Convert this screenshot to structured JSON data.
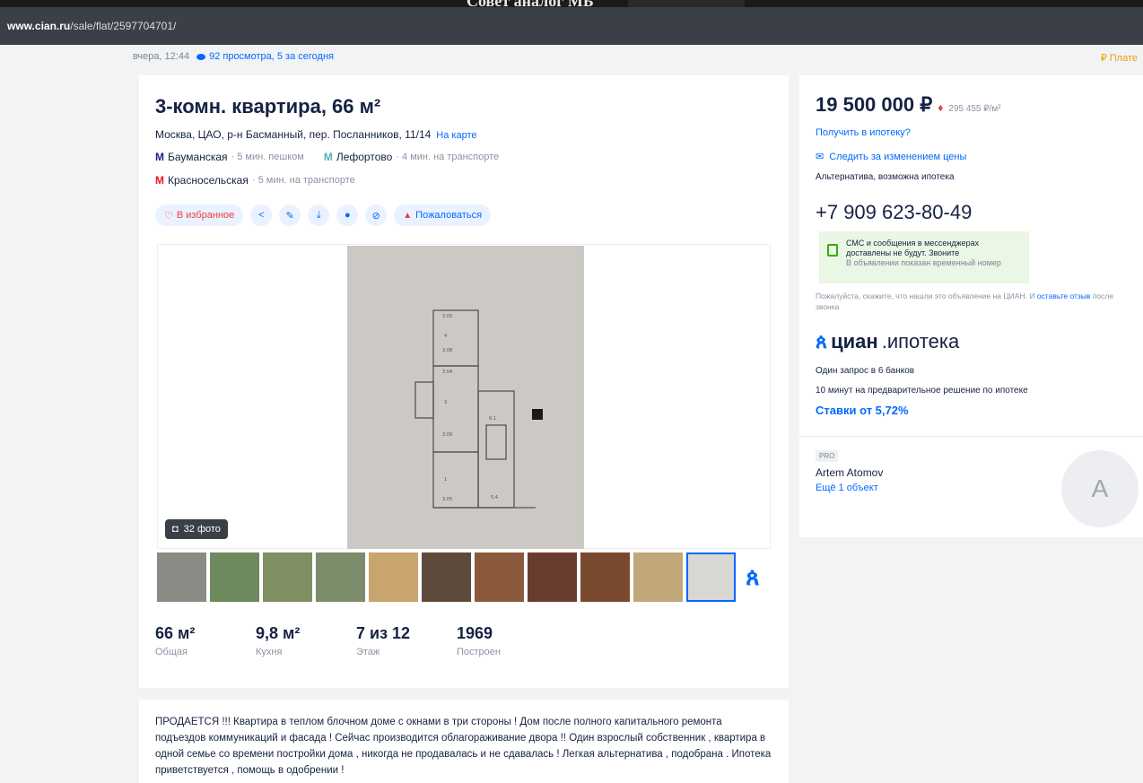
{
  "window": {
    "title": "Совет аналог МБ",
    "url_host": "www.cian.ru",
    "url_path": "/sale/flat/2597704701/"
  },
  "meta": {
    "date": "вчера, 12:44",
    "views": "92 просмотра, 5 за сегодня",
    "pay": "₽ Плате"
  },
  "listing": {
    "title": "3-комн. квартира, 66 м²",
    "address": "Москва, ЦАО, р-н Басманный, пер. Посланников, 11/14",
    "map_link": "На карте",
    "metro": [
      {
        "name": "Бауманская",
        "time": "· 5 мин. пешком",
        "color": "#1a1a8c"
      },
      {
        "name": "Лефортово",
        "time": "· 4 мин. на транспорте",
        "color": "#4fb8b4"
      },
      {
        "name": "Красносельская",
        "time": "· 5 мин. на транспорте",
        "color": "#ef161e"
      }
    ],
    "actions": {
      "favorite": "В избранное",
      "report": "Пожаловаться"
    },
    "photo_count": "32 фото",
    "stats": [
      {
        "value": "66 м²",
        "label": "Общая"
      },
      {
        "value": "9,8 м²",
        "label": "Кухня"
      },
      {
        "value": "7 из 12",
        "label": "Этаж"
      },
      {
        "value": "1969",
        "label": "Построен"
      }
    ],
    "description": "ПРОДАЕТСЯ !!! Квартира в теплом блочном доме с окнами в три стороны ! Дом после полного капитального ремонта подъездов коммуникаций и фасада ! Сейчас производится облагораживание двора !! Один взрослый собственник , квартира в одной семье со времени постройки дома , никогда не продавалась и не сдавалась ! Легкая альтернатива , подобрана . Ипотека приветствуется , помощь в одобрении !"
  },
  "sidebar": {
    "price": "19 500 000 ₽",
    "price_change_icon": "up-arrow",
    "price_per_sqm": "295 455 ₽/м²",
    "mortgage_link": "Получить в ипотеку?",
    "follow_price": "Следить за изменением цены",
    "deal_type": "Альтернатива, возможна ипотека",
    "phone": "+7 909 623-80-49",
    "sms_notice": "СМС и сообщения в мессенджерах доставлены не будут. Звоните",
    "sms_sub": "В объявлении показан временный номер",
    "call_note": "Пожалуйста, скажите, что нашли это объявление на ЦИАН. И",
    "call_note_link": "оставьте отзыв",
    "call_note_tail": "после звонка",
    "ipoteka_brand": "циан",
    "ipoteka_word": ".ипотека",
    "ipoteka_line1": "Один запрос в 6 банков",
    "ipoteka_line2": "10 минут на предварительное решение по ипотеке",
    "rates": "Ставки от 5,72%",
    "pro_badge": "PRO",
    "agent_name": "Artem Atomov",
    "agent_more": "Ещё 1 объект",
    "avatar_letter": "A"
  },
  "colors": {
    "accent": "#0468ff",
    "text": "#152242",
    "danger": "#ef3d3d"
  },
  "thumbnails": [
    "#8c8a84",
    "#6f8a5c",
    "#7d8f63",
    "#7a8c6a",
    "#c9a46c",
    "#5e4a3a",
    "#8b5a3c",
    "#6a3c2e",
    "#7a4a30",
    "#c2a77a"
  ]
}
